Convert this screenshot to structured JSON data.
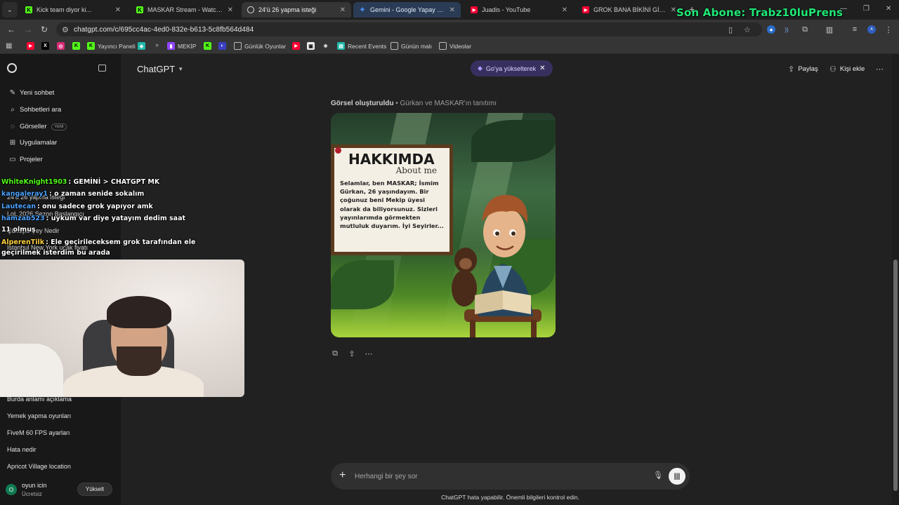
{
  "browser": {
    "tabs": [
      {
        "label": "Kick team diyor ki...",
        "active": false
      },
      {
        "label": "MASKAR Stream - Watch Live o",
        "active": false
      },
      {
        "label": "24'ü 26 yapma isteği",
        "active": true
      },
      {
        "label": "Gemini - Google Yapay Zeka'y",
        "active": false
      },
      {
        "label": "Juadis - YouTube",
        "active": false
      },
      {
        "label": "GROK BANA BİKİNİ GİYDİR. (re",
        "active": false
      }
    ],
    "url": "chatgpt.com/c/695cc4ac-4ed0-832e-b613-5c8fb564d484",
    "bookmarks": [
      "Yayıncı Paneli",
      "MEKİP",
      "Günlük Oyunlar",
      "Recent Events",
      "Günün malı",
      "Videolar"
    ],
    "colors": {
      "kick": "#53fc18",
      "youtube": "#ff0033",
      "twitch": "#9146ff",
      "gemini": "#4c8df6"
    }
  },
  "stream_overlay": {
    "subscriber_text": "Son Abone: Trabz10luPrens",
    "chat": [
      {
        "user": "WhiteKnight1903",
        "user_color": "#53fc18",
        "message": ": GEMİNİ > CHATGPT MK"
      },
      {
        "user": "kangaleray1",
        "user_color": "#4da3ff",
        "message": ": o zaman senide sokalım"
      },
      {
        "user": "Lautecan",
        "user_color": "#4da3ff",
        "message": ": onu sadece grok yapıyor amk"
      },
      {
        "user": "hamzab523",
        "user_color": "#4da3ff",
        "message": ": uykum var diye yatayım dedim saat"
      },
      {
        "user": "",
        "user_color": "#ffffff",
        "message": "11 olmuş"
      },
      {
        "user": "AlperenTilk",
        "user_color": "#ffd23f",
        "message": ": Ele geçirileceksem grok tarafından ele"
      },
      {
        "user": "",
        "user_color": "#ffffff",
        "message": "geçirilmek isterdim bu arada"
      }
    ]
  },
  "sidebar": {
    "nav": [
      {
        "label": "Yeni sohbet",
        "icon": "edit-icon"
      },
      {
        "label": "Sohbetleri ara",
        "icon": "search-icon"
      },
      {
        "label": "Görseller",
        "icon": "image-icon",
        "badge": "YENİ"
      },
      {
        "label": "Uygulamalar",
        "icon": "apps-icon"
      },
      {
        "label": "Projeler",
        "icon": "folder-icon"
      }
    ],
    "partial_chats": [
      "24'ü 26 yapma isteği",
      "LoL 2026 Sezon Başlangıcı",
      "Çüküşlü Şey Nedir",
      "İstanbul New York uçak fiyatı"
    ],
    "chats": [
      "Burda anlamı açıklama",
      "Yemek yapma oyunları",
      "FiveM 60 FPS ayarları",
      "Hata nedir",
      "Apricot Village location"
    ],
    "user": {
      "initial": "O",
      "name": "oyun icin",
      "plan": "Ücretsiz",
      "upgrade_label": "Yükselt"
    }
  },
  "header": {
    "model": "ChatGPT",
    "go_pill": "Go'ya yükselterek",
    "share_label": "Paylaş",
    "add_person_label": "Kişi ekle"
  },
  "conversation": {
    "image_caption_strong": "Görsel oluşturuldu",
    "image_caption_rest": " • Gürkan ve MASKAR'ın tanıtımı",
    "image_sign": {
      "title": "HAKKIMDA",
      "subtitle": "About me",
      "body": "Selamlar, ben MASKAR; İsmim Gürkan, 26 yaşındayım. Bir çoğunuz beni Mekip üyesi olarak da biliyorsunuz. Sizleri yayınlarımda görmekten mutluluk duyarım. İyi Seyirler..."
    }
  },
  "composer": {
    "placeholder": "Herhangi bir şey sor",
    "disclaimer": "ChatGPT hata yapabilir. Önemli bilgileri kontrol edin."
  }
}
